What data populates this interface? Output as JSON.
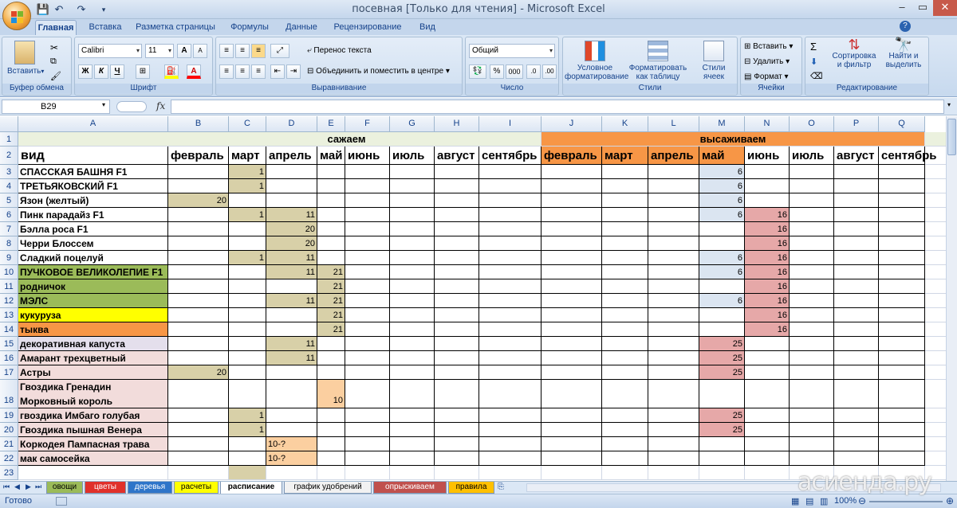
{
  "window": {
    "title": "посевная  [Только для чтения] - Microsoft Excel",
    "controls": [
      "–",
      "▭",
      "✕"
    ]
  },
  "ribbon_tabs": [
    "Главная",
    "Вставка",
    "Разметка страницы",
    "Формулы",
    "Данные",
    "Рецензирование",
    "Вид"
  ],
  "ribbon": {
    "clipboard": {
      "title": "Буфер обмена",
      "paste": "Вставить"
    },
    "font": {
      "title": "Шрифт",
      "name": "Calibri",
      "size": "11",
      "bold": "Ж",
      "italic": "К",
      "underline": "Ч"
    },
    "alignment": {
      "title": "Выравнивание",
      "wrap": "Перенос текста",
      "merge": "Объединить и поместить в центре"
    },
    "number": {
      "title": "Число",
      "format": "Общий",
      "percent": "%",
      "thousands": "000"
    },
    "styles": {
      "title": "Стили",
      "conditional": "Условное форматирование",
      "table": "Форматировать как таблицу",
      "cell_styles": "Стили ячеек"
    },
    "cells": {
      "title": "Ячейки",
      "insert": "Вставить",
      "delete": "Удалить",
      "format": "Формат"
    },
    "editing": {
      "title": "Редактирование",
      "sort": "Сортировка и фильтр",
      "find": "Найти и выделить"
    }
  },
  "formula_bar": {
    "name_box": "B29",
    "fx": "fx",
    "formula": ""
  },
  "columns": [
    "A",
    "B",
    "C",
    "D",
    "E",
    "F",
    "G",
    "H",
    "I",
    "J",
    "K",
    "L",
    "M",
    "N",
    "O",
    "P",
    "Q"
  ],
  "rows": [
    {
      "n": "1",
      "cells": {
        "C": "",
        "H": "",
        "M": ""
      }
    },
    {
      "n": "2",
      "cells": {
        "A": "вид",
        "B": "февраль",
        "C": "март",
        "D": "апрель",
        "E": "май",
        "F": "июнь",
        "G": "июль",
        "H": "август",
        "I": "сентябрь",
        "J": "февраль",
        "K": "март",
        "L": "апрель",
        "M": "май",
        "N": "июнь",
        "O": "июль",
        "P": "август",
        "Q": "сентябрь"
      }
    },
    {
      "n": "3",
      "cells": {
        "A": "СПАССКАЯ БАШНЯ F1",
        "C": "1",
        "M": "6"
      }
    },
    {
      "n": "4",
      "cells": {
        "A": "ТРЕТЬЯКОВСКИЙ F1",
        "C": "1",
        "M": "6"
      }
    },
    {
      "n": "5",
      "cells": {
        "A": "Язон (желтый)",
        "B": "20",
        "M": "6"
      }
    },
    {
      "n": "6",
      "cells": {
        "A": "Пинк парадайз F1",
        "C": "1",
        "D": "11",
        "M": "6",
        "N": "16"
      }
    },
    {
      "n": "7",
      "cells": {
        "A": "Бэлла роса F1",
        "D": "20",
        "N": "16"
      }
    },
    {
      "n": "8",
      "cells": {
        "A": "Черри Блоссем",
        "D": "20",
        "N": "16"
      }
    },
    {
      "n": "9",
      "cells": {
        "A": "Сладкий поцелуй",
        "C": "1",
        "D": "11",
        "M": "6",
        "N": "16"
      }
    },
    {
      "n": "10",
      "cells": {
        "A": "ПУЧКОВОЕ ВЕЛИКОЛЕПИЕ F1",
        "D": "11",
        "E": "21",
        "M": "6",
        "N": "16"
      }
    },
    {
      "n": "11",
      "cells": {
        "A": "родничок",
        "E": "21",
        "N": "16"
      }
    },
    {
      "n": "12",
      "cells": {
        "A": "МЭЛС",
        "D": "11",
        "E": "21",
        "M": "6",
        "N": "16"
      }
    },
    {
      "n": "13",
      "cells": {
        "A": "кукуруза",
        "E": "21",
        "N": "16"
      }
    },
    {
      "n": "14",
      "cells": {
        "A": "тыква",
        "E": "21",
        "N": "16"
      }
    },
    {
      "n": "15",
      "cells": {
        "A": "декоративная капуста",
        "D": "11",
        "M": "25"
      }
    },
    {
      "n": "16",
      "cells": {
        "A": "Амарант трехцветный",
        "D": "11",
        "M": "25"
      }
    },
    {
      "n": "17",
      "cells": {
        "A": "Астры",
        "B": "20",
        "M": "25"
      }
    },
    {
      "n": "18",
      "cells": {
        "A": "Гвоздика Гренадин",
        "A2": "Морковный король",
        "E": "10"
      }
    },
    {
      "n": "19",
      "cells": {
        "A": "гвоздика Имбаго голубая",
        "C": "1",
        "M": "25"
      }
    },
    {
      "n": "20",
      "cells": {
        "A": "Гвоздика пышная Венера",
        "C": "1",
        "M": "25"
      }
    },
    {
      "n": "21",
      "cells": {
        "A": "Коркодея Пампасная трава",
        "D": "10-?"
      }
    },
    {
      "n": "22",
      "cells": {
        "A": "мак самосейка",
        "D": "10-?"
      }
    },
    {
      "n": "23",
      "cells": {
        "A": ""
      }
    }
  ],
  "header_row1": {
    "sow": "сажаем",
    "plant": "высаживаем"
  },
  "sheet_tabs": [
    "овощи",
    "цветы",
    "деревья",
    "расчеты",
    "расписание",
    "график удобрений",
    "опрыскиваем",
    "правила"
  ],
  "status": {
    "ready": "Готово",
    "zoom": "100%"
  },
  "watermark": "асиенда.ру",
  "colors": {
    "sow_header": "#ebf1de",
    "plant_header": "#f79646",
    "tan": "#d8d0a8",
    "blue": "#dbe5f1",
    "pink": "#e6a8a8",
    "light_pink": "#f2dcdb",
    "orange_light": "#fbcfa0",
    "green": "#9bbb59",
    "yellow": "#ffff00",
    "orange": "#f79646",
    "lavender": "#e4dfec"
  }
}
